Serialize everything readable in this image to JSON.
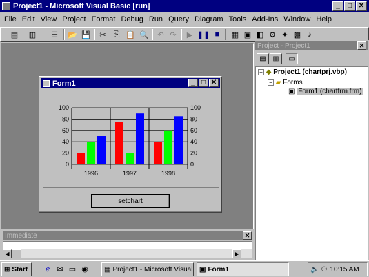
{
  "main_window": {
    "title": "Project1 - Microsoft Visual Basic [run]"
  },
  "menu": [
    "File",
    "Edit",
    "View",
    "Project",
    "Format",
    "Debug",
    "Run",
    "Query",
    "Diagram",
    "Tools",
    "Add-Ins",
    "Window",
    "Help"
  ],
  "project_pane": {
    "title": "Project - Project1",
    "root": "Project1 (chartprj.vbp)",
    "folder": "Forms",
    "item": "Form1 (chartfrm.frm)"
  },
  "form_window": {
    "title": "Form1",
    "button_label": "setchart"
  },
  "immediate": {
    "title": "Immediate"
  },
  "chart_data": {
    "type": "bar",
    "categories": [
      "1996",
      "1997",
      "1998"
    ],
    "series": [
      {
        "values": [
          20,
          75,
          40
        ]
      },
      {
        "values": [
          40,
          20,
          60
        ]
      },
      {
        "values": [
          50,
          90,
          85
        ]
      }
    ],
    "colors": [
      "#ff0000",
      "#00ff00",
      "#0000ff"
    ],
    "ylim": [
      0,
      100
    ],
    "yticks": [
      "100",
      "80",
      "60",
      "40",
      "20",
      "0"
    ],
    "grid": true
  },
  "taskbar": {
    "start": "Start",
    "task1": "Project1 - Microsoft Visual ...",
    "task2": "Form1",
    "clock": "10:15 AM"
  }
}
